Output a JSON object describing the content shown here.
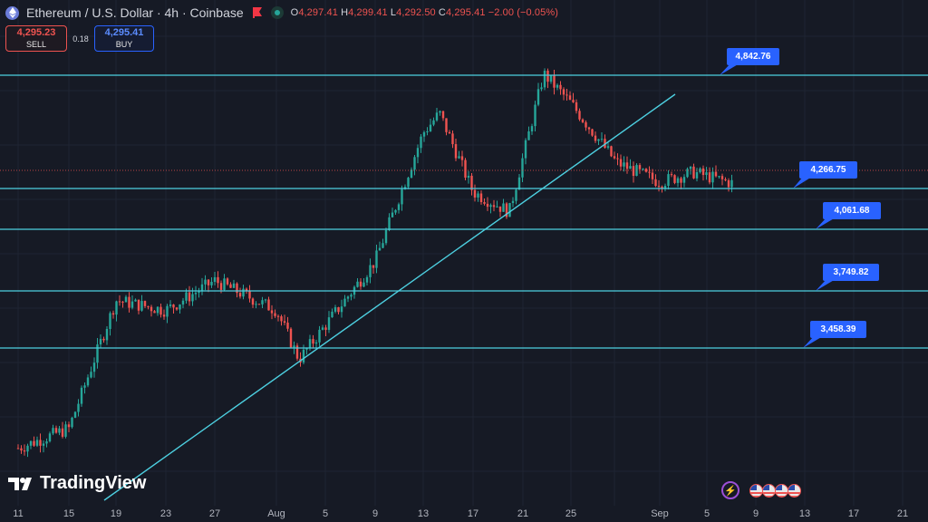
{
  "header": {
    "symbol_line": "Ethereum / U.S. Dollar · 4h · Coinbase",
    "ohlc": {
      "o_label": "O",
      "o": "4,297.41",
      "h_label": "H",
      "h": "4,299.41",
      "l_label": "L",
      "l": "4,292.50",
      "c_label": "C",
      "c": "4,295.41",
      "change": "−2.00 (−0.05%)"
    }
  },
  "trade": {
    "sell_price": "4,295.23",
    "sell_label": "SELL",
    "spread": "0.18",
    "buy_price": "4,295.41",
    "buy_label": "BUY"
  },
  "levels": [
    {
      "label": "4,842.76",
      "value": 4842.76
    },
    {
      "label": "4,266.75",
      "value": 4266.75
    },
    {
      "label": "4,061.68",
      "value": 4061.68
    },
    {
      "label": "3,749.82",
      "value": 3749.82
    },
    {
      "label": "3,458.39",
      "value": 3458.39
    }
  ],
  "xaxis_ticks": [
    "11",
    "15",
    "19",
    "23",
    "27",
    "Aug",
    "5",
    "9",
    "13",
    "17",
    "21",
    "25",
    "",
    "Sep",
    "5",
    "9",
    "13",
    "17",
    "21"
  ],
  "logo": "TradingView",
  "colors": {
    "up": "#26a69a",
    "down": "#ef5350",
    "line": "#4dd0e1",
    "label": "#2962ff",
    "bg": "#161a25"
  },
  "icons": {
    "lightning": "lightning-icon",
    "flags": "us-flag-icon"
  },
  "chart_data": {
    "type": "line",
    "x": [
      "Jul 11",
      "Jul 15",
      "Jul 19",
      "Jul 23",
      "Jul 27",
      "Aug 1",
      "Aug 5",
      "Aug 9",
      "Aug 13",
      "Aug 14",
      "Aug 17",
      "Aug 20",
      "Aug 23",
      "Aug 25",
      "Aug 28",
      "Sep 1",
      "Sep 4",
      "Sep 6"
    ],
    "series": [
      {
        "values": [
          2950,
          3050,
          3700,
          3650,
          3800,
          3650,
          3400,
          3900,
          4550,
          4650,
          4250,
          4150,
          4850,
          4700,
          4400,
          4300,
          4350,
          4295
        ]
      }
    ],
    "ylim": [
      2900,
      4950
    ]
  }
}
